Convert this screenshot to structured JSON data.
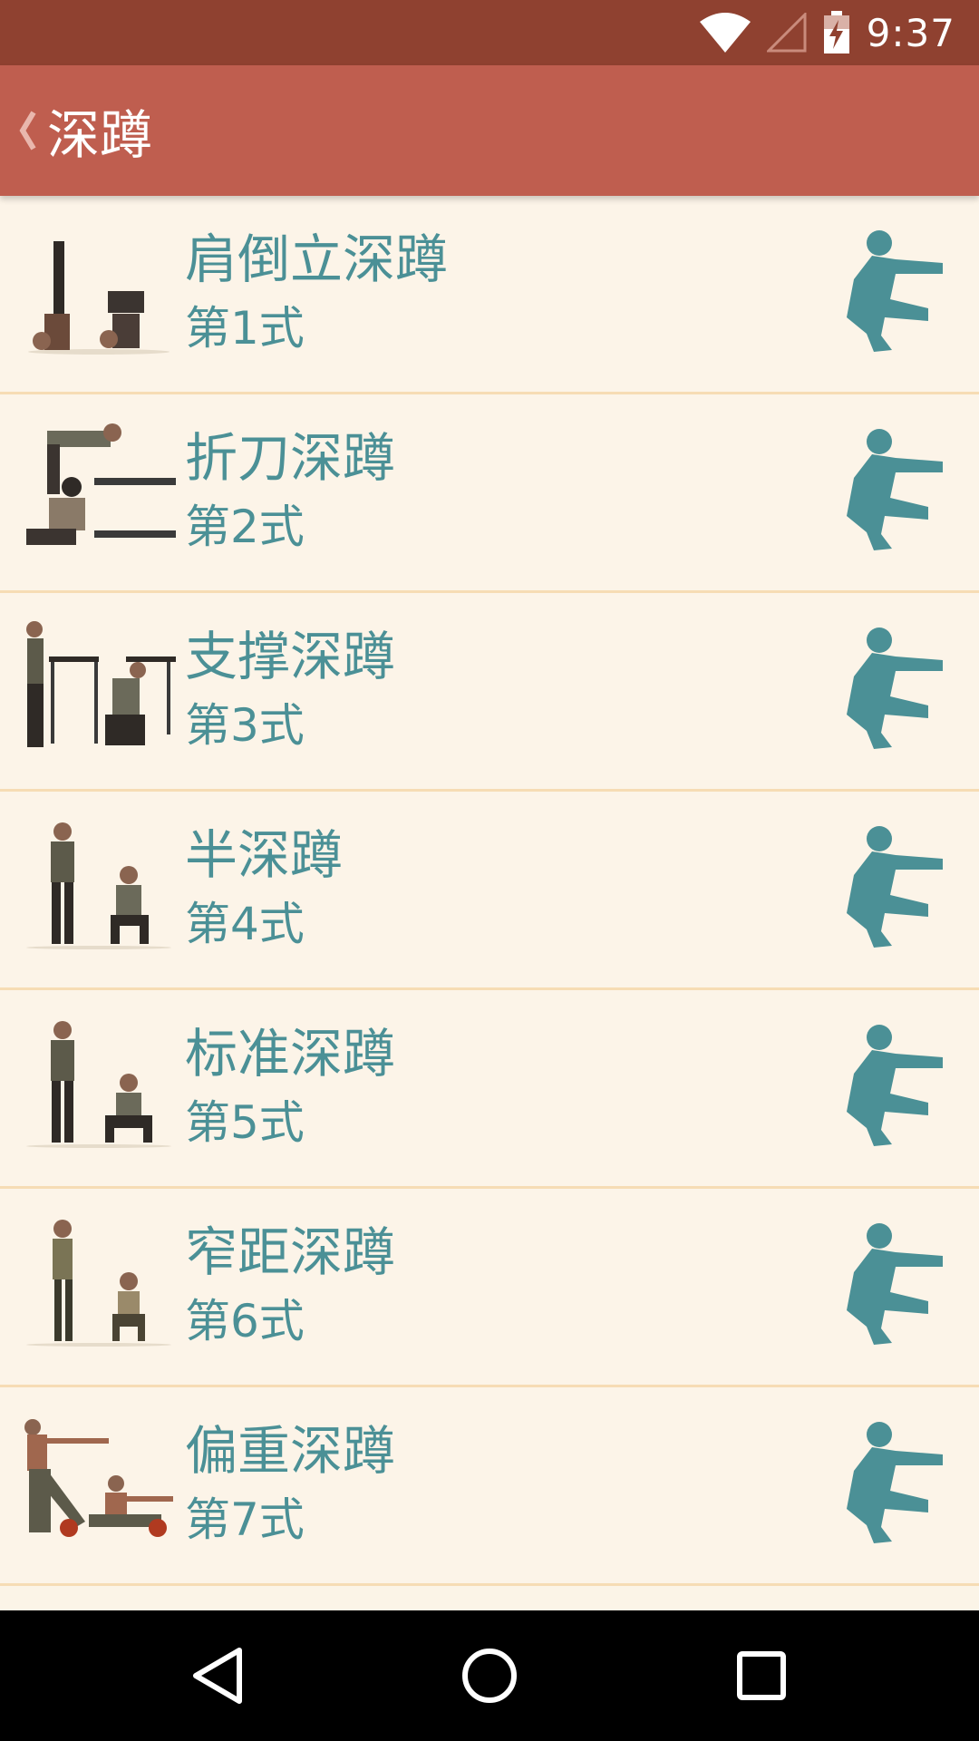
{
  "status": {
    "time": "9:37",
    "bar_color": "#8f4130"
  },
  "app_bar": {
    "title": "深蹲",
    "bar_color": "#bf5e4f",
    "back_icon": "chevron-left-icon"
  },
  "exercises": [
    {
      "title": "肩倒立深蹲",
      "subtitle": "第1式"
    },
    {
      "title": "折刀深蹲",
      "subtitle": "第2式"
    },
    {
      "title": "支撑深蹲",
      "subtitle": "第3式"
    },
    {
      "title": "半深蹲",
      "subtitle": "第4式"
    },
    {
      "title": "标准深蹲",
      "subtitle": "第5式"
    },
    {
      "title": "窄距深蹲",
      "subtitle": "第6式"
    },
    {
      "title": "偏重深蹲",
      "subtitle": "第7式"
    }
  ],
  "colors": {
    "accent_text": "#4b9096",
    "list_bg": "#fcf4e8",
    "divider": "#f6dcb4"
  },
  "nav": {
    "back_icon": "triangle-back-icon",
    "home_icon": "circle-home-icon",
    "recents_icon": "square-recents-icon"
  }
}
